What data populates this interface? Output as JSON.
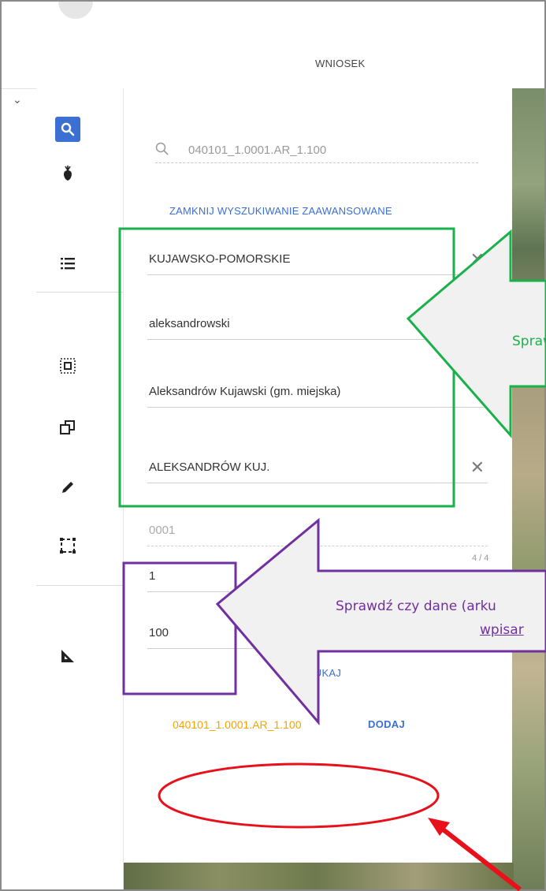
{
  "header": {
    "tab": "WNIOSEK"
  },
  "toolbar": {
    "tools": [
      "search-icon",
      "plant-icon",
      "list-icon",
      "select-area-icon",
      "copy-icon",
      "edit-pencil-icon",
      "dashed-rectangle-icon",
      "measure-ruler-icon"
    ],
    "active": "search-icon"
  },
  "panel": {
    "search": {
      "placeholder": "040101_1.0001.AR_1.100"
    },
    "advanced_link": "ZAMKNIJ WYSZUKIWANIE ZAAWANSOWANE",
    "fields": {
      "voivodeship": "KUJAWSKO-POMORSKIE",
      "county": "aleksandrowski",
      "commune": "Aleksandrów Kujawski (gm. miejska)",
      "precinct": "ALEKSANDRÓW KUJ.",
      "precinct_no": "0001",
      "counter": "4 / 4",
      "sheet": "1",
      "parcel": "100"
    },
    "search_button": "WYSZUKAJ",
    "result": {
      "id": "040101_1.0001.AR_1.100",
      "add_label": "DODAJ"
    }
  },
  "annotations": {
    "green_callout_text": "Spraw",
    "purple_callout_text": "Sprawdź czy dane (arku",
    "purple_callout_link": "wpisar",
    "colors": {
      "green": "#1ab04b",
      "purple": "#7030a0",
      "red": "#e8101a",
      "orange": "#f5a300",
      "accent": "#3b6fd1"
    }
  }
}
